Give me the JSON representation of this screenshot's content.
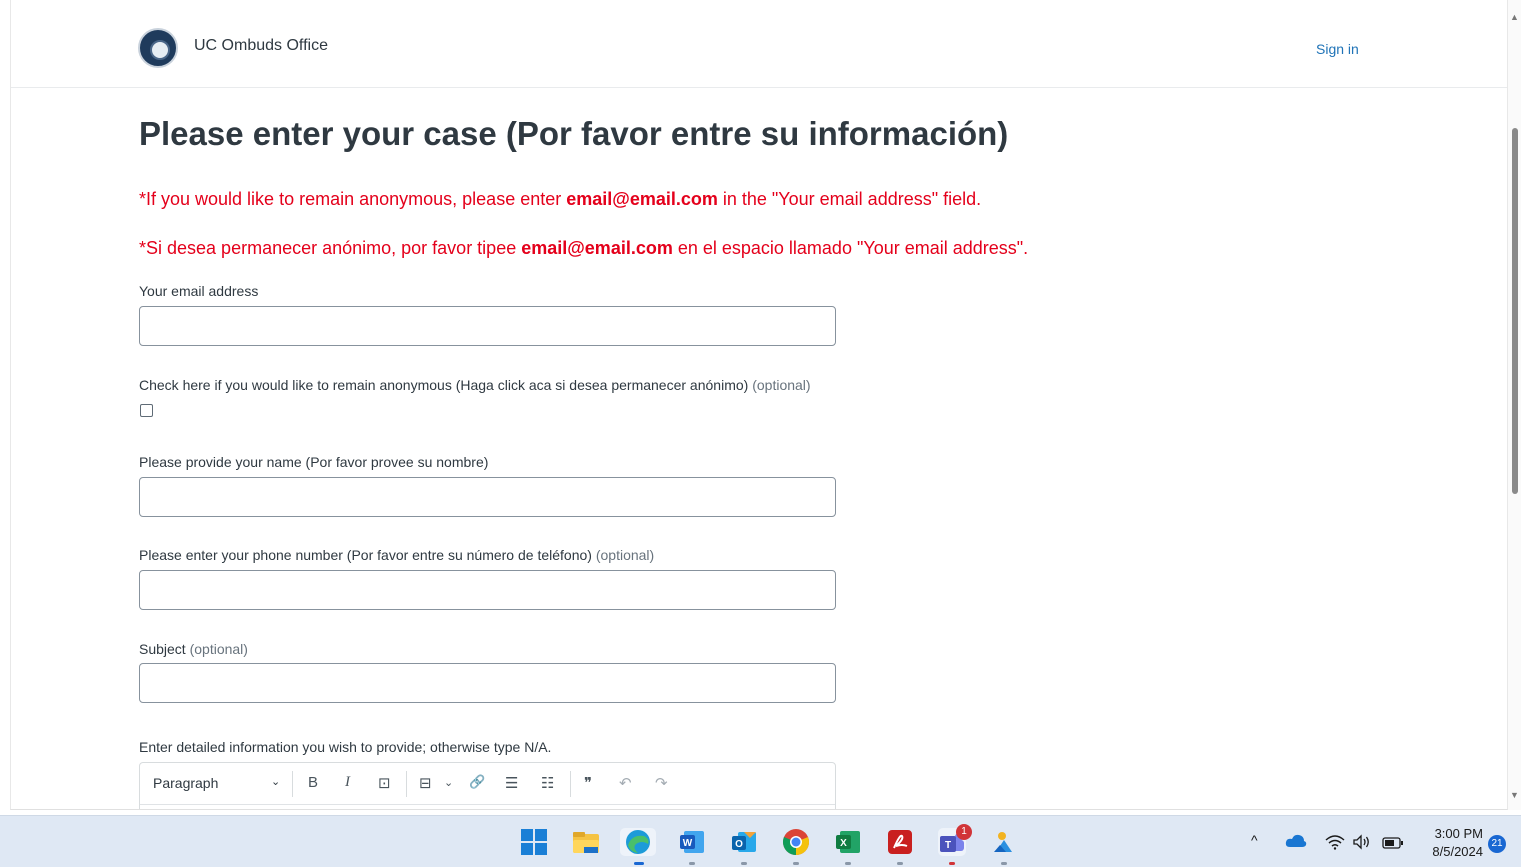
{
  "header": {
    "brand": "UC Ombuds Office",
    "sign_in": "Sign in"
  },
  "form": {
    "title": "Please enter your case (Por favor entre su información)",
    "notice_en": {
      "pre": "*If you would like to remain anonymous, please enter ",
      "email": "email@email.com",
      "post": " in the \"Your email address\" field."
    },
    "notice_es": {
      "pre": "*Si desea permanecer anónimo, por favor tipee ",
      "email": "email@email.com",
      "post": " en el espacio llamado \"Your email address\"."
    },
    "email_label": "Your email address",
    "email_value": "",
    "anonymous_label": "Check here if you would like to remain anonymous (Haga click aca si desea permanecer anónimo)",
    "optional": "(optional)",
    "anonymous_checked": false,
    "name_label": "Please provide your name (Por favor provee su nombre)",
    "name_value": "",
    "phone_label": "Please enter your phone number (Por favor entre su número de teléfono)",
    "phone_value": "",
    "subject_label": "Subject",
    "subject_value": "",
    "details_label": "Enter detailed information you wish to provide; otherwise type N/A.",
    "editor": {
      "block_format": "Paragraph",
      "caret": "⌄",
      "buttons": {
        "bold": "B",
        "italic": "I",
        "code": "⊡",
        "codeblock": "⊟",
        "codeblock_caret": "⌄",
        "link": "🔗",
        "bullets": "☰",
        "numbers": "☷",
        "quote": "❞",
        "undo": "↶",
        "redo": "↷"
      }
    }
  },
  "taskbar": {
    "time": "3:00 PM",
    "date": "8/5/2024",
    "notifications": "21",
    "teams_badge": "1",
    "tray_chevron": "^",
    "apps": [
      "windows-start",
      "file-explorer",
      "edge",
      "word",
      "outlook",
      "chrome",
      "excel",
      "acrobat",
      "teams",
      "photos"
    ],
    "colors": {
      "taskbar_bg": "#dfe8f4",
      "accent": "#1f73b7",
      "notice_red": "#e4001b"
    }
  }
}
